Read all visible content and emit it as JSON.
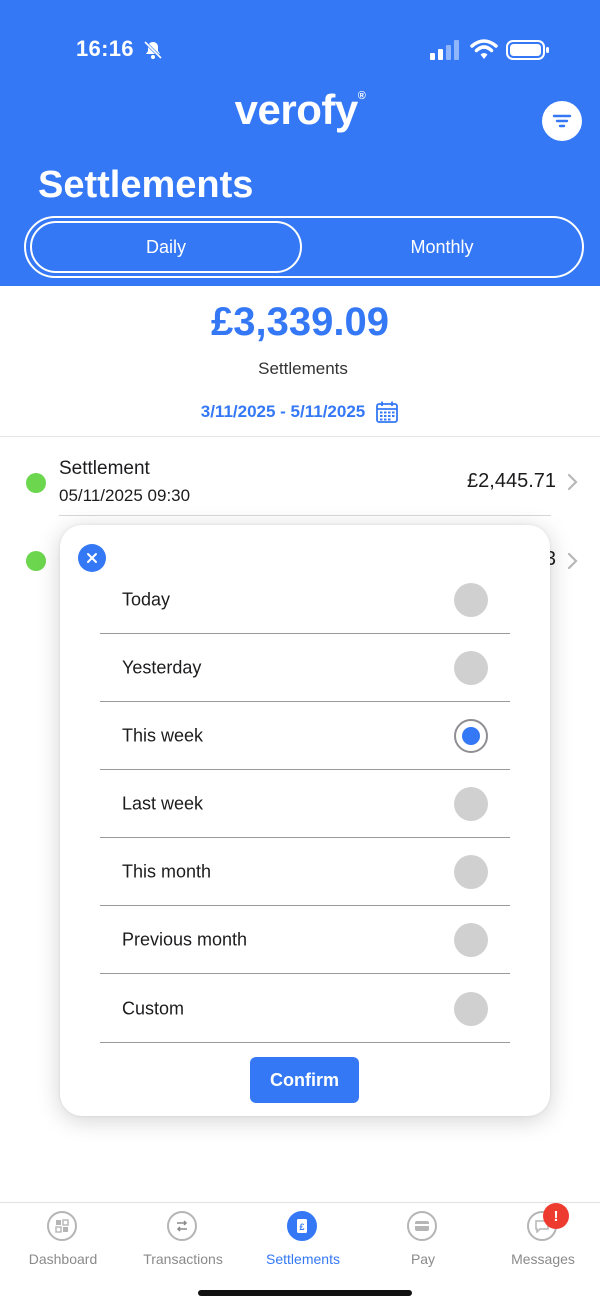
{
  "status_bar": {
    "time": "16:16"
  },
  "header": {
    "logo": "verofy",
    "logo_mark": "®",
    "title": "Settlements",
    "segments": {
      "active": "Daily",
      "inactive": "Monthly"
    }
  },
  "summary": {
    "amount": "£3,339.09",
    "label": "Settlements",
    "date_range": "3/11/2025 - 5/11/2025"
  },
  "list": [
    {
      "title": "Settlement",
      "datetime": "05/11/2025 09:30",
      "amount": "£2,445.71",
      "status_color": "#6bd64e"
    },
    {
      "title": "",
      "datetime": "",
      "amount": "3",
      "status_color": "#6bd64e"
    }
  ],
  "filter_modal": {
    "options": [
      {
        "label": "Today",
        "selected": false
      },
      {
        "label": "Yesterday",
        "selected": false
      },
      {
        "label": "This week",
        "selected": true
      },
      {
        "label": "Last week",
        "selected": false
      },
      {
        "label": "This month",
        "selected": false
      },
      {
        "label": "Previous month",
        "selected": false
      },
      {
        "label": "Custom",
        "selected": false
      }
    ],
    "confirm_label": "Confirm"
  },
  "tabbar": {
    "tabs": [
      {
        "label": "Dashboard",
        "icon": "dashboard-icon",
        "active": false
      },
      {
        "label": "Transactions",
        "icon": "transactions-icon",
        "active": false
      },
      {
        "label": "Settlements",
        "icon": "settlements-icon",
        "active": true
      },
      {
        "label": "Pay",
        "icon": "card-icon",
        "active": false
      },
      {
        "label": "Messages",
        "icon": "message-icon",
        "active": false
      }
    ],
    "messages_badge": "!"
  },
  "colors": {
    "brand": "#3478f6",
    "success": "#6bd64e",
    "alert": "#ee3b2f"
  }
}
